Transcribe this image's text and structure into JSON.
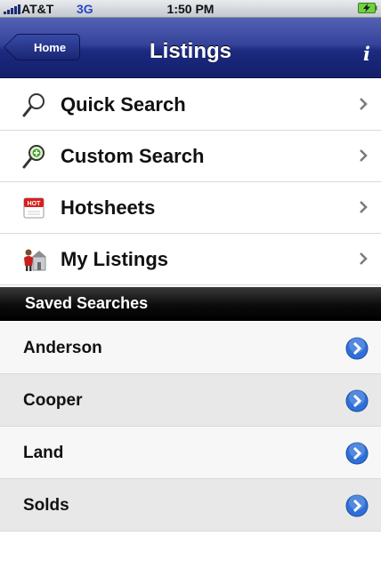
{
  "status_bar": {
    "carrier": "AT&T",
    "network": "3G",
    "time": "1:50 PM"
  },
  "nav_bar": {
    "back_label": "Home",
    "title": "Listings",
    "info_icon": "info-icon"
  },
  "menu": [
    {
      "label": "Quick Search",
      "icon": "magnifier-icon"
    },
    {
      "label": "Custom Search",
      "icon": "magnifier-plus-icon"
    },
    {
      "label": "Hotsheets",
      "icon": "hot-calendar-icon",
      "icon_text": "HOT"
    },
    {
      "label": "My Listings",
      "icon": "agent-house-icon"
    }
  ],
  "saved_searches": {
    "header": "Saved Searches",
    "items": [
      "Anderson",
      "Cooper",
      "Land",
      "Solds"
    ]
  },
  "colors": {
    "nav_bar": "#1c2a80",
    "disclosure_button": "#2e6fd8",
    "section_header": "#000000"
  }
}
